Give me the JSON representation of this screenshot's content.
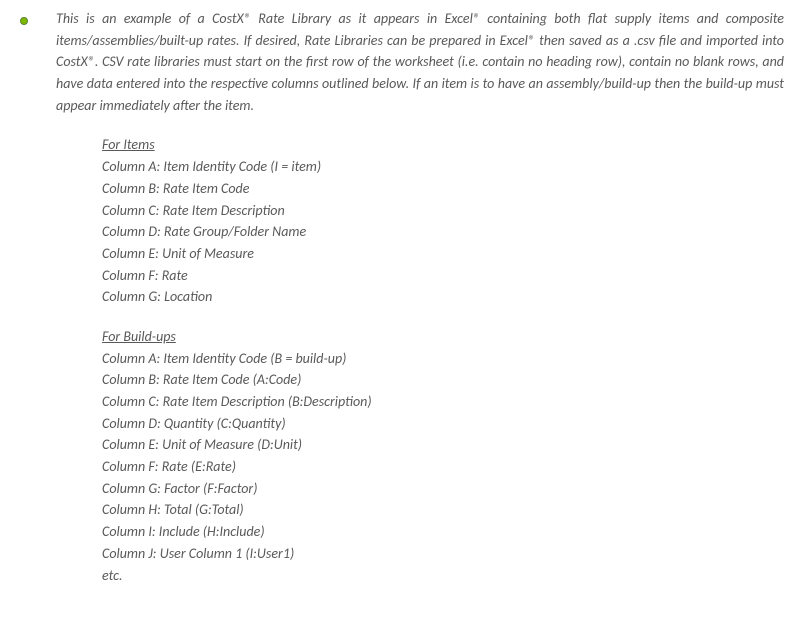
{
  "intro": "This is an example of a CostX® Rate Library as it appears in Excel® containing both flat supply items and composite items/assemblies/built-up rates. If desired, Rate Libraries can be prepared in Excel® then saved as a .csv file and imported into CostX®. CSV rate libraries must start on the first row of the worksheet (i.e. contain no heading row), contain no blank rows, and have data entered into the respective columns outlined below. If an item is to have an assembly/build-up then the build-up must appear immediately after the item.",
  "items": {
    "heading": "For Items",
    "cols": [
      "Column A: Item Identity Code (I = item)",
      "Column B: Rate Item Code",
      "Column C: Rate Item Description",
      "Column D: Rate Group/Folder Name",
      "Column E: Unit of Measure",
      "Column F: Rate",
      "Column G: Location"
    ]
  },
  "buildups": {
    "heading": "For Build-ups",
    "cols": [
      "Column A: Item Identity Code (B = build-up)",
      "Column B: Rate Item Code (A:Code)",
      "Column C: Rate Item Description (B:Description)",
      "Column D: Quantity (C:Quantity)",
      "Column E: Unit of Measure (D:Unit)",
      "Column F: Rate (E:Rate)",
      "Column G: Factor (F:Factor)",
      "Column H: Total (G:Total)",
      "Column I: Include (H:Include)",
      "Column J: User Column 1 (I:User1)",
      "etc."
    ]
  }
}
